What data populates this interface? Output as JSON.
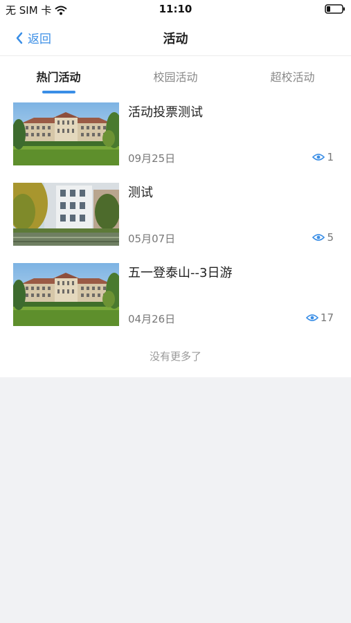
{
  "status_bar": {
    "carrier": "无 SIM 卡",
    "time": "11:10"
  },
  "nav": {
    "back_label": "返回",
    "title": "活动"
  },
  "tabs": [
    {
      "label": "热门活动",
      "active": true
    },
    {
      "label": "校园活动",
      "active": false
    },
    {
      "label": "超校活动",
      "active": false
    }
  ],
  "activities": [
    {
      "title": "活动投票测试",
      "date": "09月25日",
      "views": "1",
      "image": "campus-building-photo"
    },
    {
      "title": "测试",
      "date": "05月07日",
      "views": "5",
      "image": "lakeside-building-photo"
    },
    {
      "title": "五一登泰山--3日游",
      "date": "04月26日",
      "views": "17",
      "image": "campus-building-photo"
    }
  ],
  "footer": {
    "no_more_text": "没有更多了"
  },
  "colors": {
    "accent": "#3a8ee6",
    "page_background": "#f1f2f4"
  }
}
